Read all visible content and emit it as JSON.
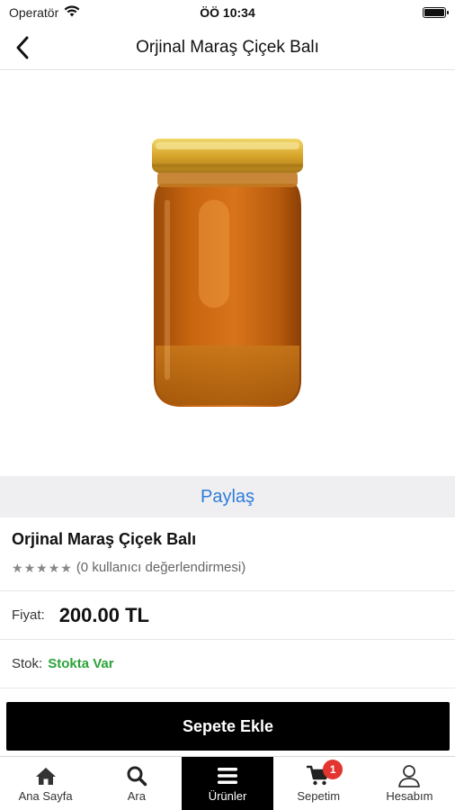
{
  "status_bar": {
    "carrier": "Operatör",
    "time": "ÖÖ 10:34"
  },
  "nav": {
    "title": "Orjinal Maraş Çiçek Balı",
    "back_icon": "chevron-left-icon"
  },
  "share": {
    "label": "Paylaş"
  },
  "product": {
    "name": "Orjinal Maraş Çiçek Balı",
    "rating_stars": 0,
    "rating_text": "(0 kullanıcı değerlendirmesi)",
    "price_label": "Fiyat:",
    "price": "200.00 TL",
    "stock_label": "Stok:",
    "stock_value": "Stokta Var",
    "stock_color": "#2aa33a"
  },
  "actions": {
    "add_to_cart": "Sepete Ekle"
  },
  "tabs": [
    {
      "label": "Ana Sayfa",
      "icon": "home-icon",
      "active": false
    },
    {
      "label": "Ara",
      "icon": "search-icon",
      "active": false
    },
    {
      "label": "Ürünler",
      "icon": "menu-icon",
      "active": true
    },
    {
      "label": "Sepetim",
      "icon": "cart-icon",
      "active": false,
      "badge": "1"
    },
    {
      "label": "Hesabım",
      "icon": "user-icon",
      "active": false
    }
  ],
  "colors": {
    "accent_link": "#2f7cd9",
    "badge": "#e3342f",
    "primary_button": "#000000"
  }
}
